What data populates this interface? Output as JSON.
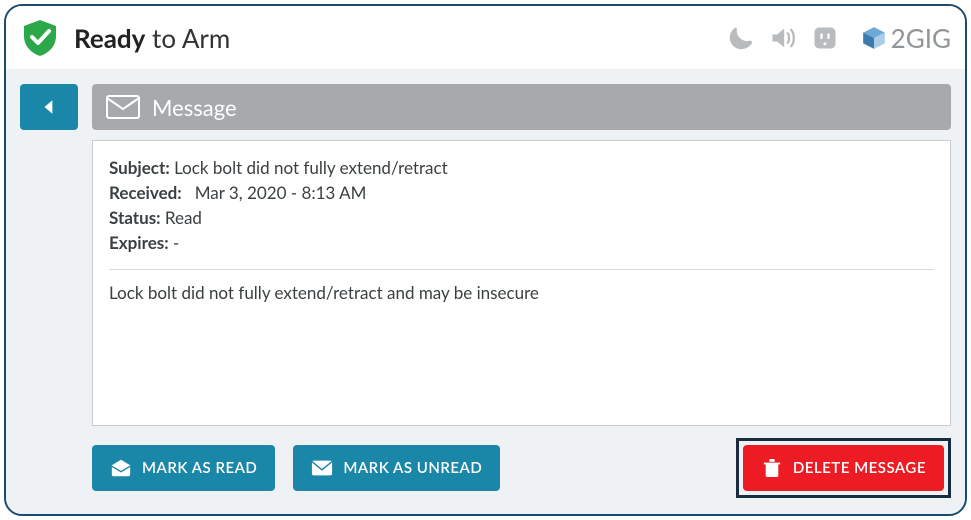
{
  "header": {
    "status_strong": "Ready",
    "status_rest": " to Arm",
    "brand": "2GIG"
  },
  "page": {
    "title": "Message"
  },
  "message": {
    "subject_label": "Subject:",
    "subject_value": "Lock bolt did not fully extend/retract",
    "received_label": "Received:",
    "received_value": "Mar 3, 2020 - 8:13 AM",
    "status_label": "Status:",
    "status_value": "Read",
    "expires_label": "Expires:",
    "expires_value": "-",
    "body": "Lock bolt did not fully extend/retract and may be insecure"
  },
  "buttons": {
    "mark_read": "MARK AS READ",
    "mark_unread": "MARK AS UNREAD",
    "delete": "DELETE MESSAGE"
  }
}
